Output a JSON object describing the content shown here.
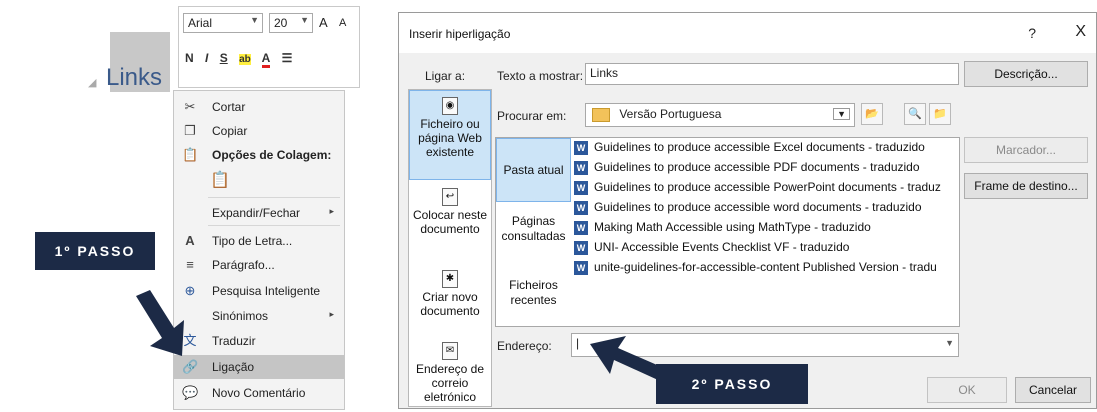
{
  "doc": {
    "heading": "Links"
  },
  "mini_toolbar": {
    "font": "Arial",
    "size": "20",
    "grow": "A",
    "shrink": "A",
    "bold": "N",
    "italic": "I",
    "underline": "S",
    "highlight": "ab",
    "fontcolor": "A"
  },
  "context_menu": {
    "items": [
      {
        "label": "Cortar",
        "icon": "scissors-icon"
      },
      {
        "label": "Copiar",
        "icon": "copy-icon"
      },
      {
        "label": "Opções de Colagem:",
        "icon": "paste-icon"
      },
      {
        "label": "Expandir/Fechar",
        "icon": "",
        "submenu": "▸"
      },
      {
        "label": "Tipo de Letra...",
        "icon": "font-icon"
      },
      {
        "label": "Parágrafo...",
        "icon": "paragraph-icon"
      },
      {
        "label": "Pesquisa Inteligente",
        "icon": "smart-lookup-icon"
      },
      {
        "label": "Sinónimos",
        "icon": "",
        "submenu": "▸"
      },
      {
        "label": "Traduzir",
        "icon": "translate-icon"
      },
      {
        "label": "Ligação",
        "icon": "link-icon"
      },
      {
        "label": "Novo Comentário",
        "icon": "comment-icon"
      }
    ]
  },
  "badges": {
    "step1": "1º PASSO",
    "step2": "2º PASSO"
  },
  "dialog": {
    "title": "Inserir hiperligação",
    "help": "?",
    "close": "X",
    "link_to_label": "Ligar a:",
    "text_to_display_label": "Texto a mostrar:",
    "text_to_display_value": "Links",
    "description_button": "Descrição...",
    "look_in_label": "Procurar em:",
    "look_in_value": "Versão Portuguesa",
    "bookmark_button": "Marcador...",
    "target_frame_button": "Frame de destino...",
    "link_options": [
      "Ficheiro ou página Web existente",
      "Colocar neste documento",
      "Criar novo documento",
      "Endereço de correio eletrónico"
    ],
    "folder_options": [
      "Pasta atual",
      "Páginas consultadas",
      "Ficheiros recentes"
    ],
    "files": [
      "Guidelines to produce accessible Excel documents - traduzido",
      "Guidelines to produce accessible PDF documents - traduzido",
      "Guidelines to produce accessible PowerPoint documents - traduz",
      "Guidelines to produce accessible word documents - traduzido",
      "Making Math Accessible using MathType - traduzido",
      "UNI- Accessible Events Checklist VF - traduzido",
      "unite-guidelines-for-accessible-content Published Version - tradu"
    ],
    "address_label": "Endereço:",
    "address_value": "|",
    "ok_button": "OK",
    "cancel_button": "Cancelar"
  },
  "colors": {
    "badge": "#1c2a46",
    "selection": "#cce4f7",
    "arrow": "#1c2a46"
  }
}
